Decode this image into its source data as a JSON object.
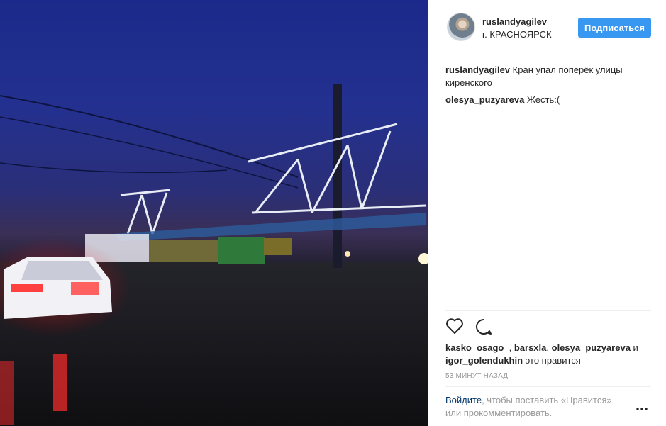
{
  "post": {
    "username": "ruslandyagilev",
    "location": "г. КРАСНОЯРСК",
    "follow_label": "Подписаться"
  },
  "comments": [
    {
      "author": "ruslandyagilev",
      "text": "Кран упал поперёк улицы киренского"
    },
    {
      "author": "olesya_puzyareva",
      "text": "Жесть:("
    }
  ],
  "likes": {
    "user1": "kasko_osago_",
    "sep1": ", ",
    "user2": "barsxla",
    "sep2": ", ",
    "user3": "olesya_puzyareva",
    "and": " и ",
    "user4": "igor_golendukhin",
    "suffix": " это нравится"
  },
  "timestamp": "53 минут назад",
  "login": {
    "link": "Войдите",
    "text": ", чтобы поставить «Нравится» или прокомментировать."
  },
  "icons": {
    "like": "heart-outline-icon",
    "comment": "speech-bubble-icon",
    "more": "more-dots-icon"
  },
  "colors": {
    "follow_button": "#3897f0",
    "link": "#003569",
    "muted": "#999999"
  }
}
